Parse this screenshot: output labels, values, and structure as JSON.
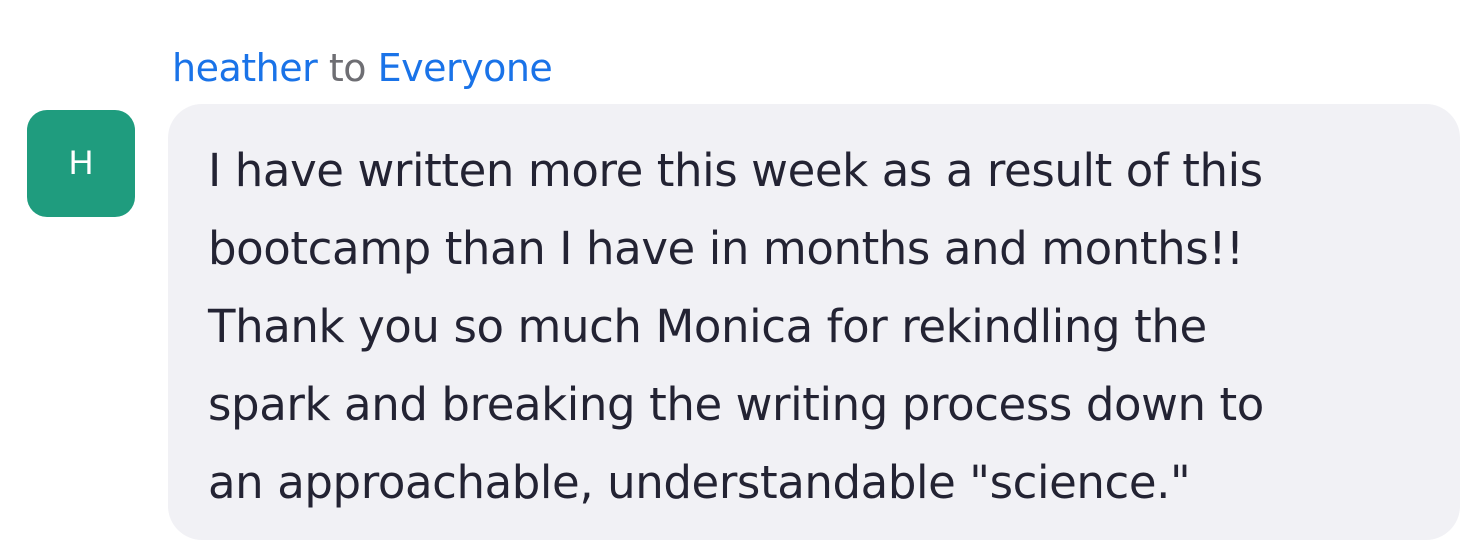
{
  "message": {
    "sender": "heather",
    "to_word": "to",
    "recipient": "Everyone",
    "avatar": {
      "initial": "H",
      "color": "#1f9c7e"
    },
    "lines": [
      "I have written more this week as a result of this",
      "bootcamp than I have in months and months!!",
      "Thank you so much Monica for rekindling the",
      "spark and breaking the writing process down to",
      "an approachable, understandable \"science.\""
    ]
  }
}
